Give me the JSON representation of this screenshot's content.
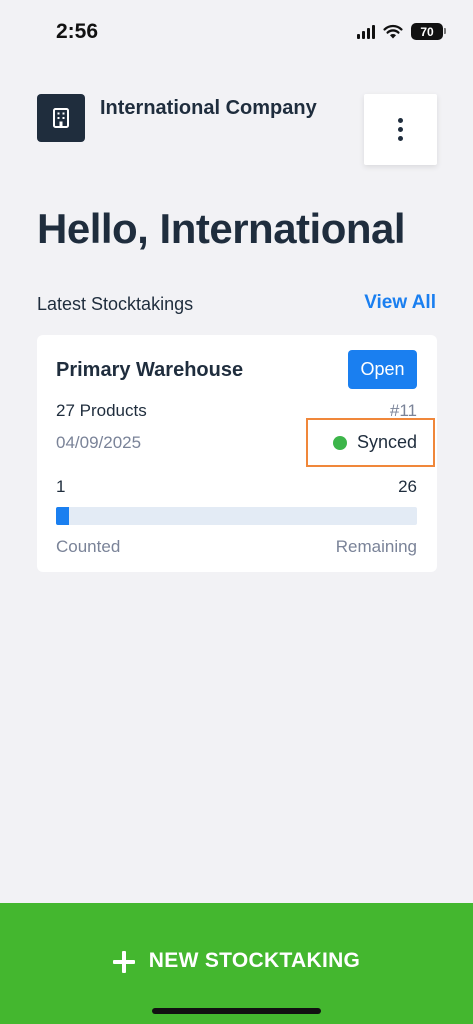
{
  "status_bar": {
    "time": "2:56",
    "battery": "70"
  },
  "header": {
    "company_name": "International Company",
    "logo_icon": "building-icon",
    "menu_icon": "more-vertical-icon"
  },
  "greeting": {
    "prefix": "Hello, ",
    "name": "International"
  },
  "section": {
    "title": "Latest Stocktakings",
    "view_all": "View All"
  },
  "stocktaking": {
    "title": "Primary Warehouse",
    "status": "Open",
    "products": "27 Products",
    "number": "#11",
    "date": "04/09/2025",
    "sync_status": "Synced",
    "counted_value": "1",
    "remaining_value": "26",
    "progress_fraction": 0.037,
    "counted_label": "Counted",
    "remaining_label": "Remaining"
  },
  "actions": {
    "new_stocktaking": "NEW STOCKTAKING"
  },
  "colors": {
    "accent": "#1a7ff0",
    "primary_dark": "#1f2d3d",
    "success_green": "#44b72f",
    "sync_dot": "#3cb54a",
    "highlight_orange": "#f0873a"
  }
}
